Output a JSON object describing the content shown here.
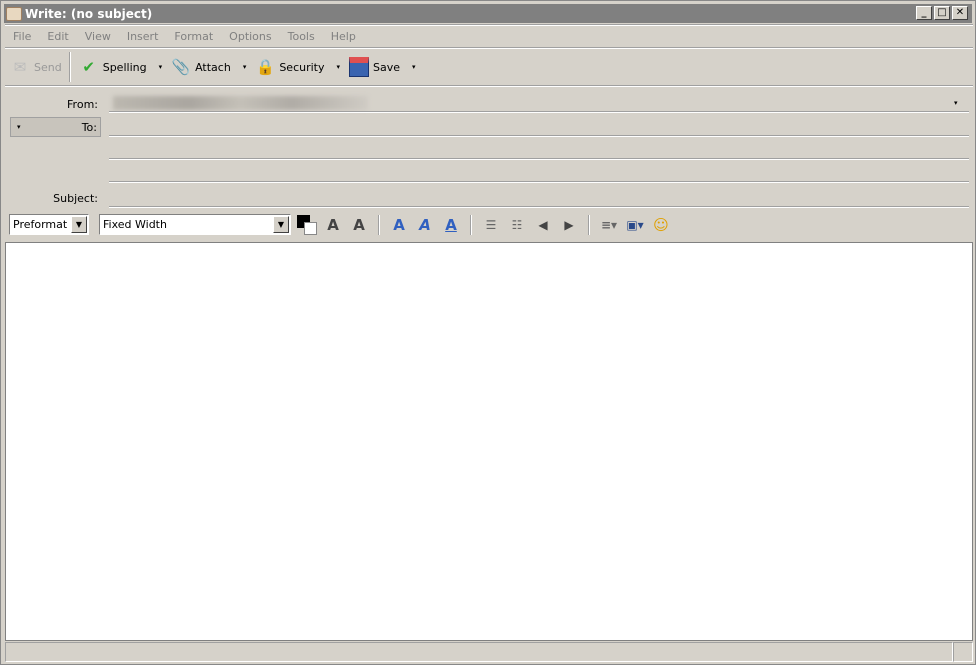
{
  "window": {
    "title": "Write: (no subject)",
    "minimize": "_",
    "maximize": "□",
    "close": "✕"
  },
  "menu": [
    "File",
    "Edit",
    "View",
    "Insert",
    "Format",
    "Options",
    "Tools",
    "Help"
  ],
  "toolbar": {
    "send": "Send",
    "spelling": "Spelling",
    "attach": "Attach",
    "security": "Security",
    "save": "Save",
    "dropdown": "▾"
  },
  "header": {
    "from_label": "From:",
    "to_label": "To:",
    "subject_label": "Subject:",
    "subject_value": "",
    "to_dropdown": "▾"
  },
  "format_bar": {
    "paragraph_style": "Preformat",
    "font": "Fixed Width",
    "arrow": "▼"
  }
}
